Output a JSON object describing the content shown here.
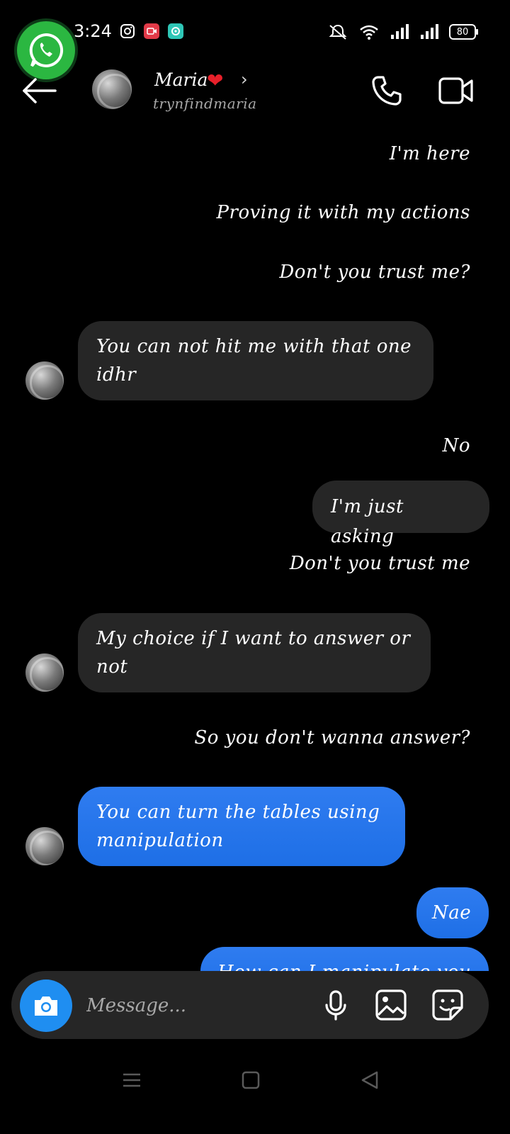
{
  "status_bar": {
    "time": "3:24",
    "battery": "80"
  },
  "header": {
    "name": "Maria",
    "heart": "❤",
    "chevron": "›",
    "handle": "trynfindmaria"
  },
  "messages": [
    {
      "side": "sent",
      "style": "plain",
      "text": "I'm here"
    },
    {
      "side": "sent",
      "style": "plain",
      "text": "Proving it with my actions"
    },
    {
      "side": "sent",
      "style": "plain",
      "text": "Don't you trust me?"
    },
    {
      "side": "received",
      "style": "grey",
      "line1": "You can not hit me with that one",
      "line2": "idhr"
    },
    {
      "side": "sent",
      "style": "plain",
      "text": "No"
    },
    {
      "side": "sent",
      "style": "grey",
      "text": "I'm just asking"
    },
    {
      "side": "sent",
      "style": "plain",
      "text": "Don't you trust me"
    },
    {
      "side": "received",
      "style": "grey",
      "line1": "My choice if I want to answer or",
      "line2": "not"
    },
    {
      "side": "sent",
      "style": "plain",
      "text": "So you don't wanna answer?"
    },
    {
      "side": "received",
      "style": "blue",
      "line1": "You can turn the tables using",
      "line2": "manipulation"
    },
    {
      "side": "sent",
      "style": "blue",
      "text": "Nae"
    },
    {
      "side": "sent",
      "style": "blue",
      "text": "How can I manipulate you"
    }
  ],
  "composer": {
    "placeholder": "Message..."
  },
  "colors": {
    "background": "#000000",
    "bubble_grey": "#262626",
    "bubble_blue": "#1e6fe6",
    "camera_button": "#1f8ef1",
    "heart": "#e8202a",
    "whatsapp": "#2bb741"
  },
  "icons": [
    "whatsapp-icon",
    "instagram-icon",
    "screen-record-icon",
    "app-icon",
    "mute-icon",
    "wifi-icon",
    "signal-icon",
    "battery-icon",
    "back-arrow-icon",
    "phone-icon",
    "video-camera-icon",
    "camera-icon",
    "microphone-icon",
    "gallery-icon",
    "sticker-icon",
    "menu-icon",
    "home-icon",
    "back-icon"
  ]
}
